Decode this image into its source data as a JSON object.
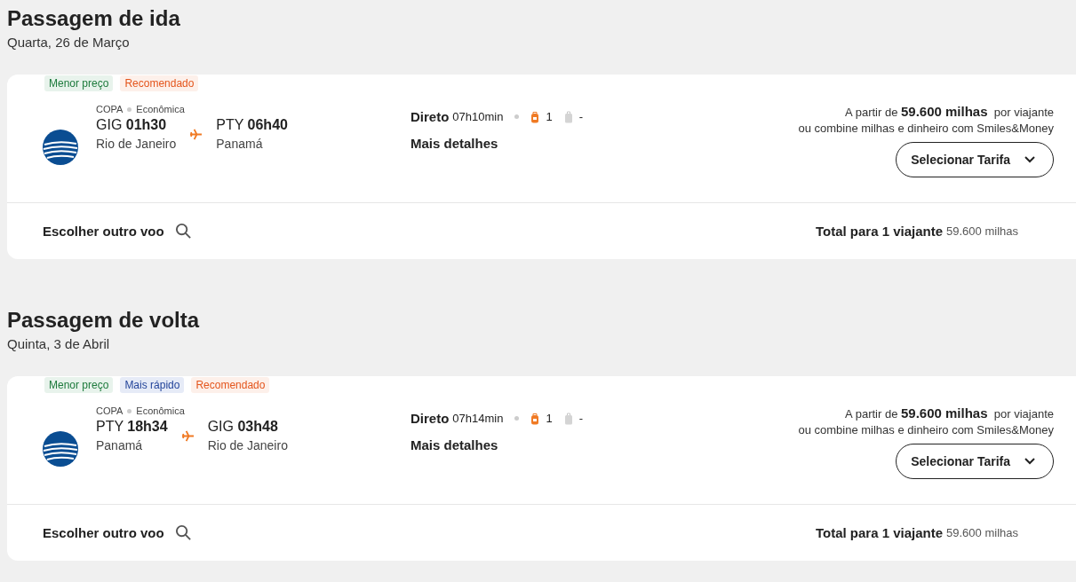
{
  "sections": [
    {
      "title": "Passagem de ida",
      "date": "Quarta, 26 de Março",
      "flight": {
        "tags": [
          {
            "label": "Menor preço",
            "kind": "cheapest"
          },
          {
            "label": "Recomendado",
            "kind": "recommended"
          }
        ],
        "airline": "COPA",
        "cabin": "Econômica",
        "origin": {
          "code": "GIG",
          "time": "01h30",
          "city": "Rio de Janeiro"
        },
        "destination": {
          "code": "PTY",
          "time": "06h40",
          "city": "Panamá"
        },
        "stops": "Direto",
        "duration": "07h10min",
        "baggage": [
          {
            "kind": "backpack",
            "included": true,
            "count": "1"
          },
          {
            "kind": "suitcase",
            "included": false,
            "count": "-"
          }
        ],
        "details_link": "Mais detalhes",
        "price_text": "A partir de **59.600 milhas**  por viajante",
        "combine_text": "ou combine milhas e dinheiro com Smiles&Money",
        "select_button": "Selecionar Tarifa",
        "other_flight": "Escolher outro voo",
        "total_label": "Total para 1 viajante",
        "total_value": "59.600 milhas"
      }
    },
    {
      "title": "Passagem de volta",
      "date": "Quinta, 3 de Abril",
      "flight": {
        "tags": [
          {
            "label": "Menor preço",
            "kind": "cheapest"
          },
          {
            "label": "Mais rápido",
            "kind": "fastest"
          },
          {
            "label": "Recomendado",
            "kind": "recommended"
          }
        ],
        "airline": "COPA",
        "cabin": "Econômica",
        "origin": {
          "code": "PTY",
          "time": "18h34",
          "city": "Panamá"
        },
        "destination": {
          "code": "GIG",
          "time": "03h48",
          "city": "Rio de Janeiro"
        },
        "stops": "Direto",
        "duration": "07h14min",
        "baggage": [
          {
            "kind": "backpack",
            "included": true,
            "count": "1"
          },
          {
            "kind": "suitcase",
            "included": false,
            "count": "-"
          }
        ],
        "details_link": "Mais detalhes",
        "price_text": "A partir de **59.600 milhas**  por viajante",
        "combine_text": "ou combine milhas e dinheiro com Smiles&Money",
        "select_button": "Selecionar Tarifa",
        "other_flight": "Escolher outro voo",
        "total_label": "Total para 1 viajante",
        "total_value": "59.600 milhas"
      }
    }
  ]
}
